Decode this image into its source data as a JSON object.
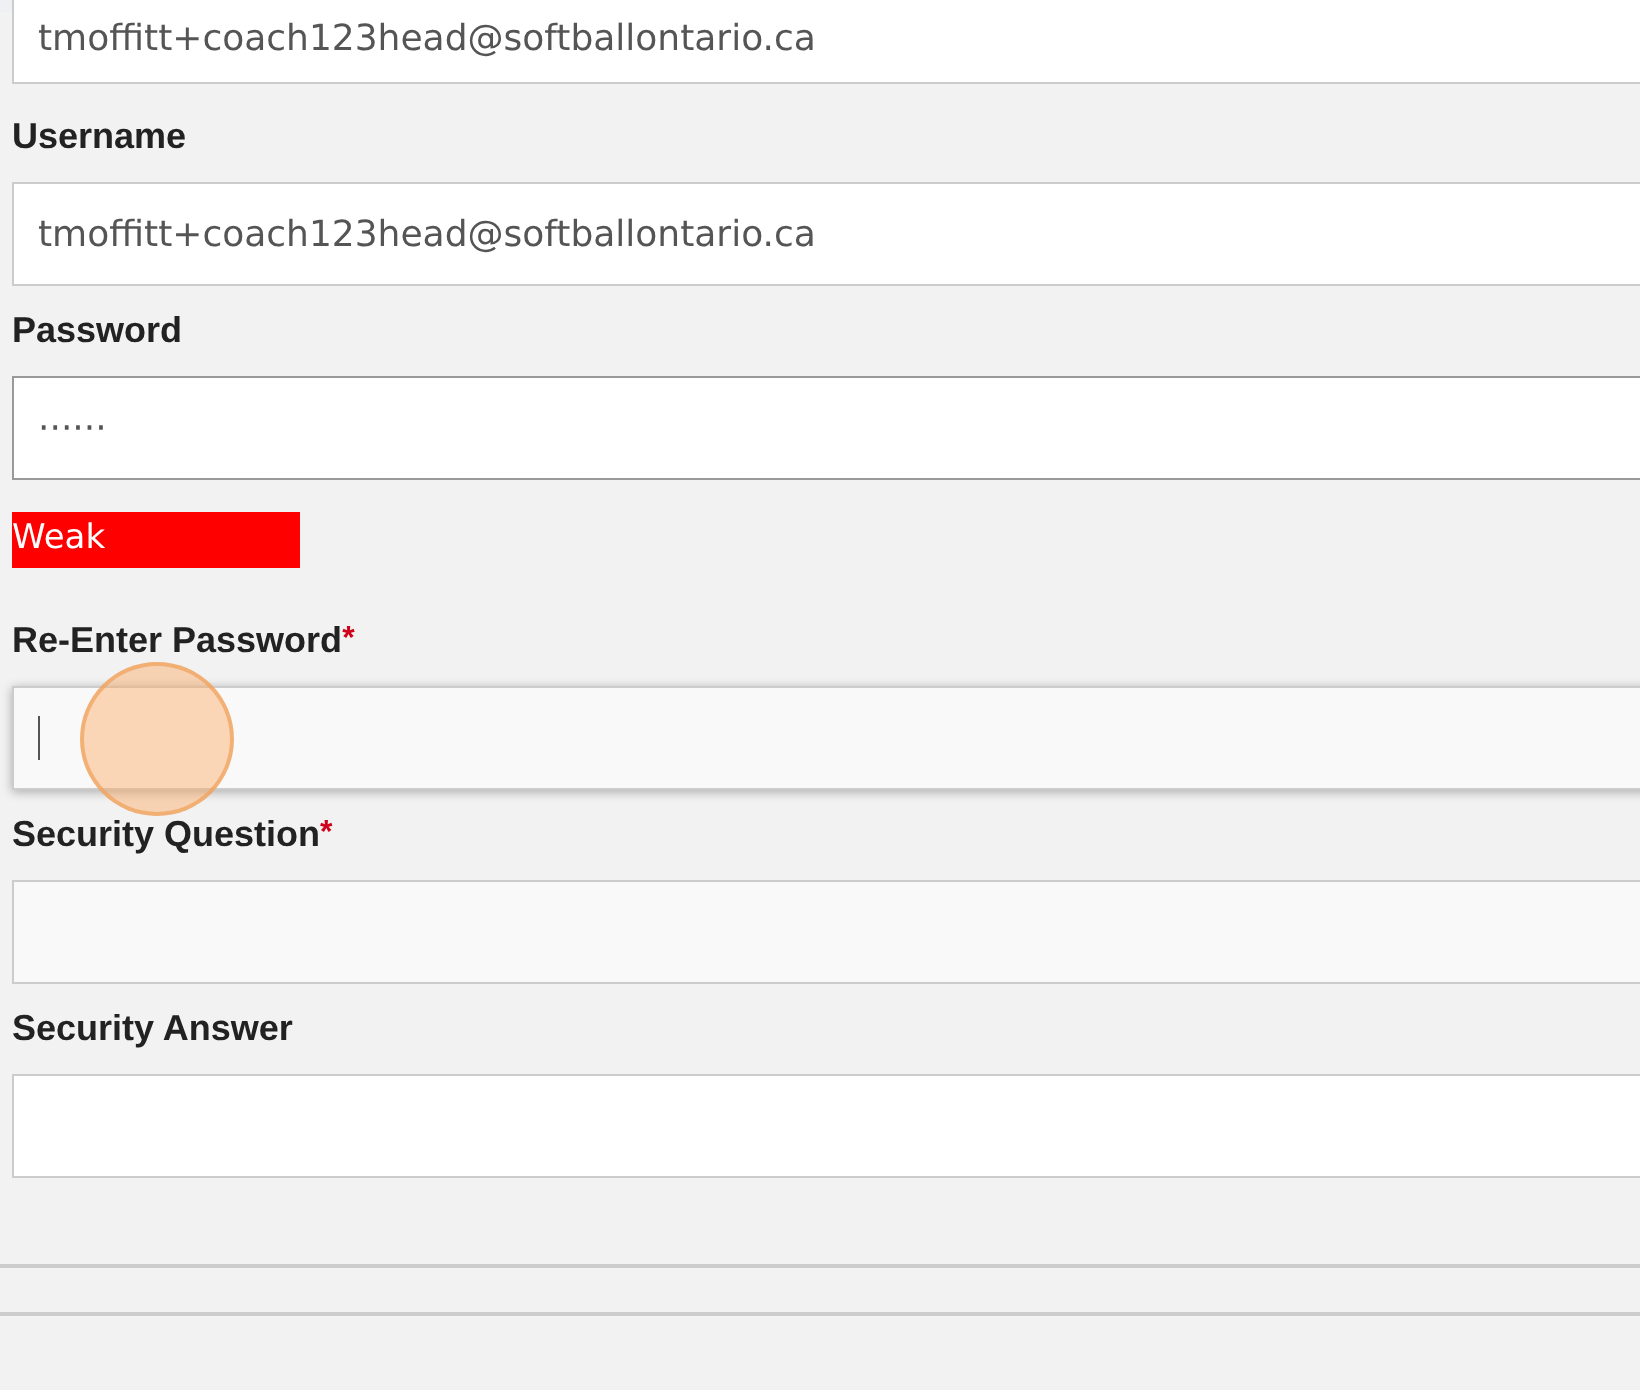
{
  "email_field": {
    "value": "tmoffitt+coach123head@softballontario.ca"
  },
  "fields": [
    {
      "kind": "text",
      "label": "Username",
      "value": "tmoffitt+coach123head@softballontario.ca",
      "focused": false
    },
    {
      "kind": "password",
      "label": "Password",
      "value": "······",
      "focused": false,
      "strength": "Weak"
    },
    {
      "kind": "password",
      "label": "Re-Enter Password",
      "required_mark": "*",
      "focused": true
    },
    {
      "kind": "select",
      "label": "Security Question",
      "required_mark": "*",
      "focused": false
    },
    {
      "kind": "text",
      "label": "Security Answer",
      "focused": false
    }
  ]
}
